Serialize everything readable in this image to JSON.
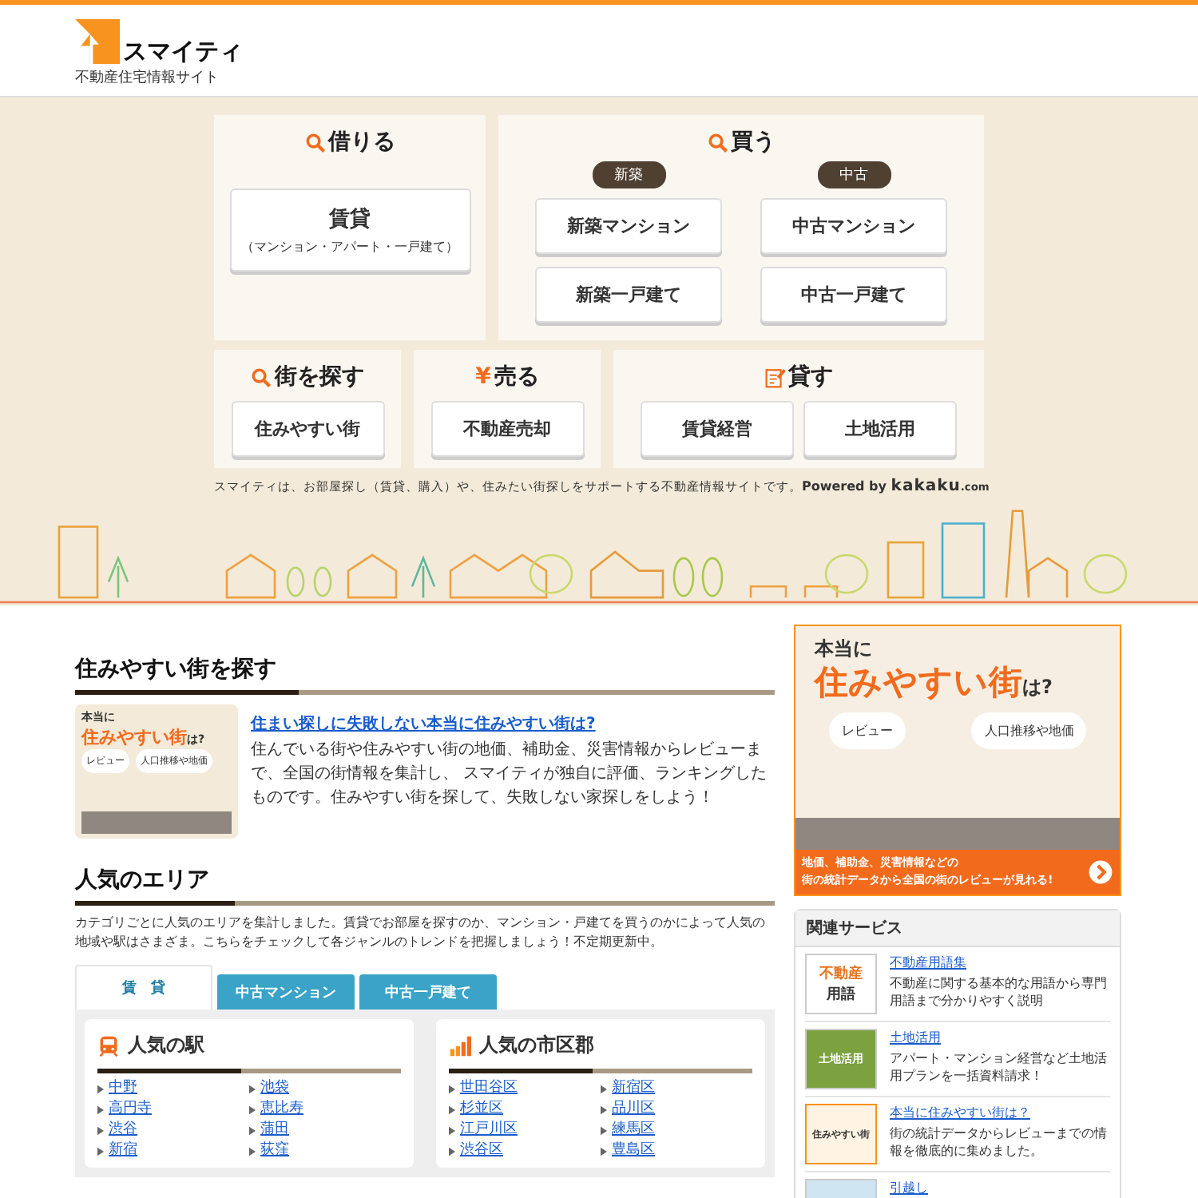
{
  "header": {
    "logo_text": "スマイティ",
    "tagline": "不動産住宅情報サイト"
  },
  "hero": {
    "rent": {
      "title": "借りる",
      "button": {
        "label": "賃貸",
        "sub": "（マンション・アパート・一戸建て）"
      }
    },
    "buy": {
      "title": "買う",
      "columns": [
        {
          "badge": "新築",
          "buttons": [
            "新築マンション",
            "新築一戸建て"
          ]
        },
        {
          "badge": "中古",
          "buttons": [
            "中古マンション",
            "中古一戸建て"
          ]
        }
      ]
    },
    "small_panels": [
      {
        "icon": {
          "kind": "search"
        },
        "title": "街を探す",
        "buttons": [
          "住みやすい街"
        ]
      },
      {
        "icon": {
          "kind": "glyph",
          "text": "¥"
        },
        "title": "売る",
        "buttons": [
          "不動産売却"
        ]
      },
      {
        "icon": {
          "kind": "memo"
        },
        "title": "貸す",
        "buttons": [
          "賃貸経営",
          "土地活用"
        ]
      }
    ],
    "description": "スマイティは、お部屋探し（賃貸、購入）や、住みたい街探しをサポートする不動産情報サイトです。",
    "powered": {
      "prefix": "Powered by",
      "brand": "kakaku",
      "suffix": ".com"
    }
  },
  "town_section": {
    "title": "住みやすい街を探す",
    "thumb": {
      "line1": "本当に",
      "line2": "住みやすい街",
      "line3": "は?",
      "bubble1": "レビュー",
      "bubble2": "人口推移や地価"
    },
    "link": "住まい探しに失敗しない本当に住みやすい街は?",
    "body": "住んでいる街や住みやすい街の地価、補助金、災害情報からレビューまで、全国の街情報を集計し、 スマイティが独自に評価、ランキングしたものです。住みやすい街を探して、失敗しない家探しをしよう！"
  },
  "area_section": {
    "title": "人気のエリア",
    "intro": "カテゴリごとに人気のエリアを集計しました。賃貸でお部屋を探すのか、マンション・戸建てを買うのかによって人気の地域や駅はさまざま。こちらをチェックして各ジャンルのトレンドを把握しましょう！不定期更新中。",
    "tabs": [
      {
        "label": "賃　貸",
        "selected": true
      },
      {
        "label": "中古マンション",
        "selected": false
      },
      {
        "label": "中古一戸建て",
        "selected": false
      }
    ],
    "boxes": [
      {
        "title": "人気の駅",
        "links": [
          "中野",
          "池袋",
          "高円寺",
          "恵比寿",
          "渋谷",
          "蒲田",
          "新宿",
          "荻窪"
        ]
      },
      {
        "title": "人気の市区郡",
        "links": [
          "世田谷区",
          "新宿区",
          "杉並区",
          "品川区",
          "江戸川区",
          "練馬区",
          "渋谷区",
          "豊島区"
        ]
      }
    ]
  },
  "sidebar": {
    "banner": {
      "line1": "本当に",
      "line2": "住みやすい街",
      "line3": "は?",
      "bubble1": "レビュー",
      "bubble2": "人口推移や地価",
      "footer_lines": [
        "地価、補助金、災害情報などの",
        "街の統計データから全国の街のレビューが見れる!"
      ]
    },
    "related": {
      "title": "関連サービス",
      "items": [
        {
          "thumb_lines": [
            "不動産",
            "用語"
          ],
          "link": "不動産用語集",
          "desc": "不動産に関する基本的な用語から専門用語まで分かりやすく説明"
        },
        {
          "thumb_lines": [
            "土地活用"
          ],
          "link": "土地活用",
          "desc": "アパート・マンション経営など土地活用プランを一括資料請求！"
        },
        {
          "thumb_lines": [
            "住みやすい街"
          ],
          "link": "本当に住みやすい街は？",
          "desc": "街の統計データからレビューまでの情報を徹底的に集めました。"
        },
        {
          "link": "引越し"
        }
      ]
    }
  }
}
